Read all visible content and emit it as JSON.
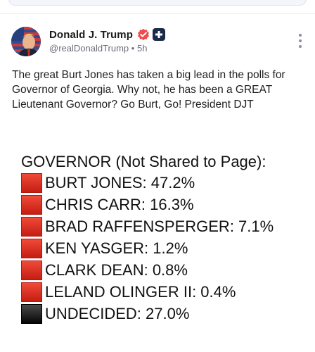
{
  "header": {
    "name": "Donald J. Trump",
    "handle": "@realDonaldTrump",
    "separator": "•",
    "time": "5h"
  },
  "post": {
    "text": "The great Burt Jones has taken a big lead in the polls for Governor of Georgia. Why not, he has been a GREAT Lieutenant Governor? Go Burt, Go! President DJT"
  },
  "poll": {
    "title": "GOVERNOR (Not Shared to Page):",
    "rows": [
      {
        "label": "BURT JONES: 47.2%",
        "color": "red"
      },
      {
        "label": "CHRIS CARR: 16.3%",
        "color": "red"
      },
      {
        "label": "BRAD RAFFENSPERGER: 7.1%",
        "color": "red"
      },
      {
        "label": "KEN YASGER: 1.2%",
        "color": "red"
      },
      {
        "label": "CLARK DEAN: 0.8%",
        "color": "red"
      },
      {
        "label": "LELAND OLINGER II: 0.4%",
        "color": "red"
      },
      {
        "label": "UNDECIDED: 27.0%",
        "color": "black"
      }
    ]
  },
  "colors": {
    "verified_badge": "#f04b4b",
    "plus_badge": "#1c2b4a",
    "swatch_red": "#d9281c",
    "swatch_black": "#111111"
  },
  "icons": {
    "verified": "verified-badge-icon",
    "plus": "plus-badge-icon",
    "more": "more-options-icon"
  }
}
